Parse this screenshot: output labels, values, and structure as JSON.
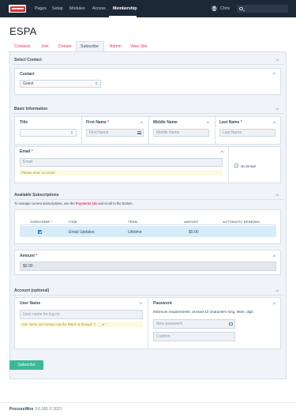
{
  "masthead": {
    "nav": [
      "Pages",
      "Setup",
      "Modules",
      "Access",
      "Membership"
    ],
    "active": "Membership",
    "user": "Chris",
    "search_placeholder": ""
  },
  "page_title": "ESPA",
  "tabs": [
    "Contacts",
    "Join",
    "Donate",
    "Subscribe",
    "Admin",
    "View Site"
  ],
  "active_tab": "Subscribe",
  "sections": {
    "select_contact": {
      "header": "Select Contact",
      "label": "Contact",
      "value": "Guest"
    },
    "basic_info": {
      "header": "Basic Information",
      "title_label": "Title",
      "first_name_label": "First Name",
      "first_name_placeholder": "First Name",
      "middle_name_label": "Middle Name",
      "middle_name_placeholder": "Middle Name",
      "last_name_label": "Last Name",
      "last_name_placeholder": "Last Name",
      "email_label": "Email",
      "email_placeholder": "Email",
      "email_error": "Please enter an email",
      "no_email_label": "No Email",
      "required_mark": "*"
    },
    "subscriptions": {
      "header": "Available Subscriptions",
      "notice_prefix": "To manage current subscriptions, use the ",
      "notice_link": "Payments tab",
      "notice_suffix": " and scroll to the bottom.",
      "columns": [
        "SUBSCRIBE",
        "ITEM",
        "TERM",
        "AMOUNT",
        "AUTOMATIC RENEWAL"
      ],
      "rows": [
        {
          "subscribe": true,
          "item": "Email Updates",
          "term": "Lifetime",
          "amount": "$0.00",
          "renewal": ""
        }
      ]
    },
    "amount": {
      "label": "Amount",
      "value": "$0.00"
    },
    "account": {
      "header": "Account (optional)",
      "username_label": "User Name",
      "username_placeholder": "User name for log on",
      "username_help": "User name can contain only the letters 'a' through 'z', '_' or '.'",
      "password_label": "Password",
      "password_requirements": "Minimum requirements: at least 10 characters long, letter, digit.",
      "new_password_placeholder": "New password",
      "confirm_placeholder": "Confirm"
    }
  },
  "submit_label": "Subscribe",
  "footer": {
    "brand": "ProcessWire",
    "version": "3.0.165 © 2021"
  },
  "colors": {
    "masthead": "#1c2836",
    "link": "#e83561",
    "button": "#3eb998",
    "highlight": "#d7ebf8"
  }
}
